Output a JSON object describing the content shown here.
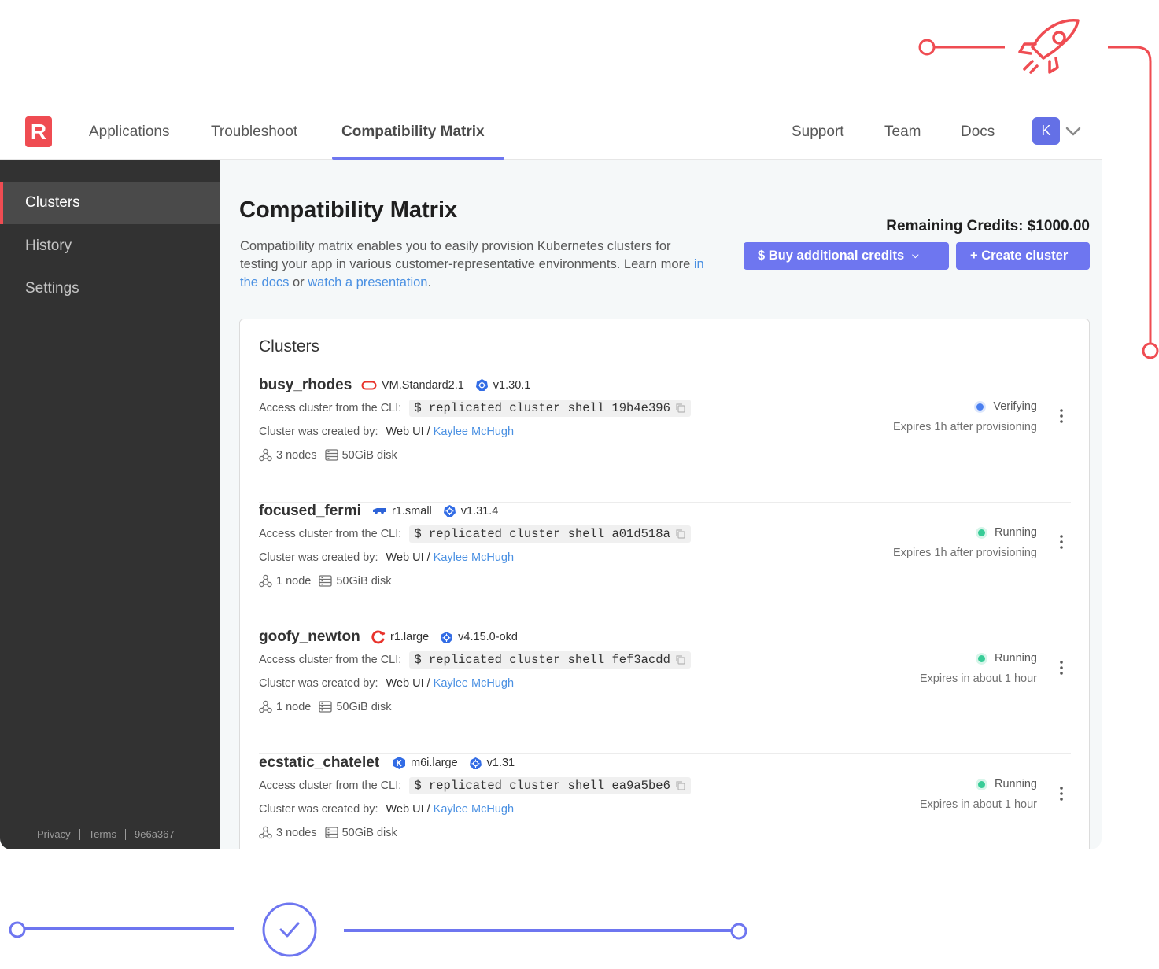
{
  "header": {
    "logo_letter": "R",
    "nav": [
      "Applications",
      "Troubleshoot",
      "Compatibility Matrix"
    ],
    "right_nav": [
      "Support",
      "Team",
      "Docs"
    ],
    "avatar_letter": "K"
  },
  "sidebar": {
    "items": [
      "Clusters",
      "History",
      "Settings"
    ],
    "footer": {
      "privacy": "Privacy",
      "terms": "Terms",
      "version": "9e6a367"
    }
  },
  "page": {
    "title": "Compatibility Matrix",
    "desc_before": "Compatibility matrix enables you to easily provision Kubernetes clusters for testing your app in various customer-representative environments. Learn more ",
    "docs_link": "in the docs",
    "desc_middle": " or ",
    "presentation_link": "watch a presentation",
    "desc_after": ".",
    "credits": "Remaining Credits: $1000.00",
    "buy_button": "$ Buy additional credits",
    "create_button": "+ Create cluster"
  },
  "clusters_card": {
    "title": "Clusters",
    "cli_label": "Access cluster from the CLI:",
    "created_label": "Cluster was created by:",
    "created_source": "Web UI /",
    "items": [
      {
        "name": "busy_rhodes",
        "instance": "VM.Standard2.1",
        "version": "v1.30.1",
        "provider_icon": "oracle-icon",
        "cli": "$ replicated cluster shell 19b4e396",
        "creator": "Kaylee McHugh",
        "nodes": "3 nodes",
        "disk": "50GiB disk",
        "status": "Verifying",
        "status_color": "#4a7ff0",
        "expires": "Expires 1h after provisioning"
      },
      {
        "name": "focused_fermi",
        "instance": "r1.small",
        "version": "v1.31.4",
        "provider_icon": "kind-icon",
        "cli": "$ replicated cluster shell a01d518a",
        "creator": "Kaylee McHugh",
        "nodes": "1 node",
        "disk": "50GiB disk",
        "status": "Running",
        "status_color": "#38cc97",
        "expires": "Expires 1h after provisioning"
      },
      {
        "name": "goofy_newton",
        "instance": "r1.large",
        "version": "v4.15.0-okd",
        "provider_icon": "openshift-icon",
        "cli": "$ replicated cluster shell fef3acdd",
        "creator": "Kaylee McHugh",
        "nodes": "1 node",
        "disk": "50GiB disk",
        "status": "Running",
        "status_color": "#38cc97",
        "expires": "Expires in about 1 hour"
      },
      {
        "name": "ecstatic_chatelet",
        "instance": "m6i.large",
        "version": "v1.31",
        "provider_icon": "k3s-icon",
        "cli": "$ replicated cluster shell ea9a5be6",
        "creator": "Kaylee McHugh",
        "nodes": "3 nodes",
        "disk": "50GiB disk",
        "status": "Running",
        "status_color": "#38cc97",
        "expires": "Expires in about 1 hour"
      }
    ]
  },
  "colors": {
    "brand_red": "#ef4c52",
    "accent": "#6e76f0",
    "link": "#4a90e2",
    "sidebar": "#323232"
  }
}
